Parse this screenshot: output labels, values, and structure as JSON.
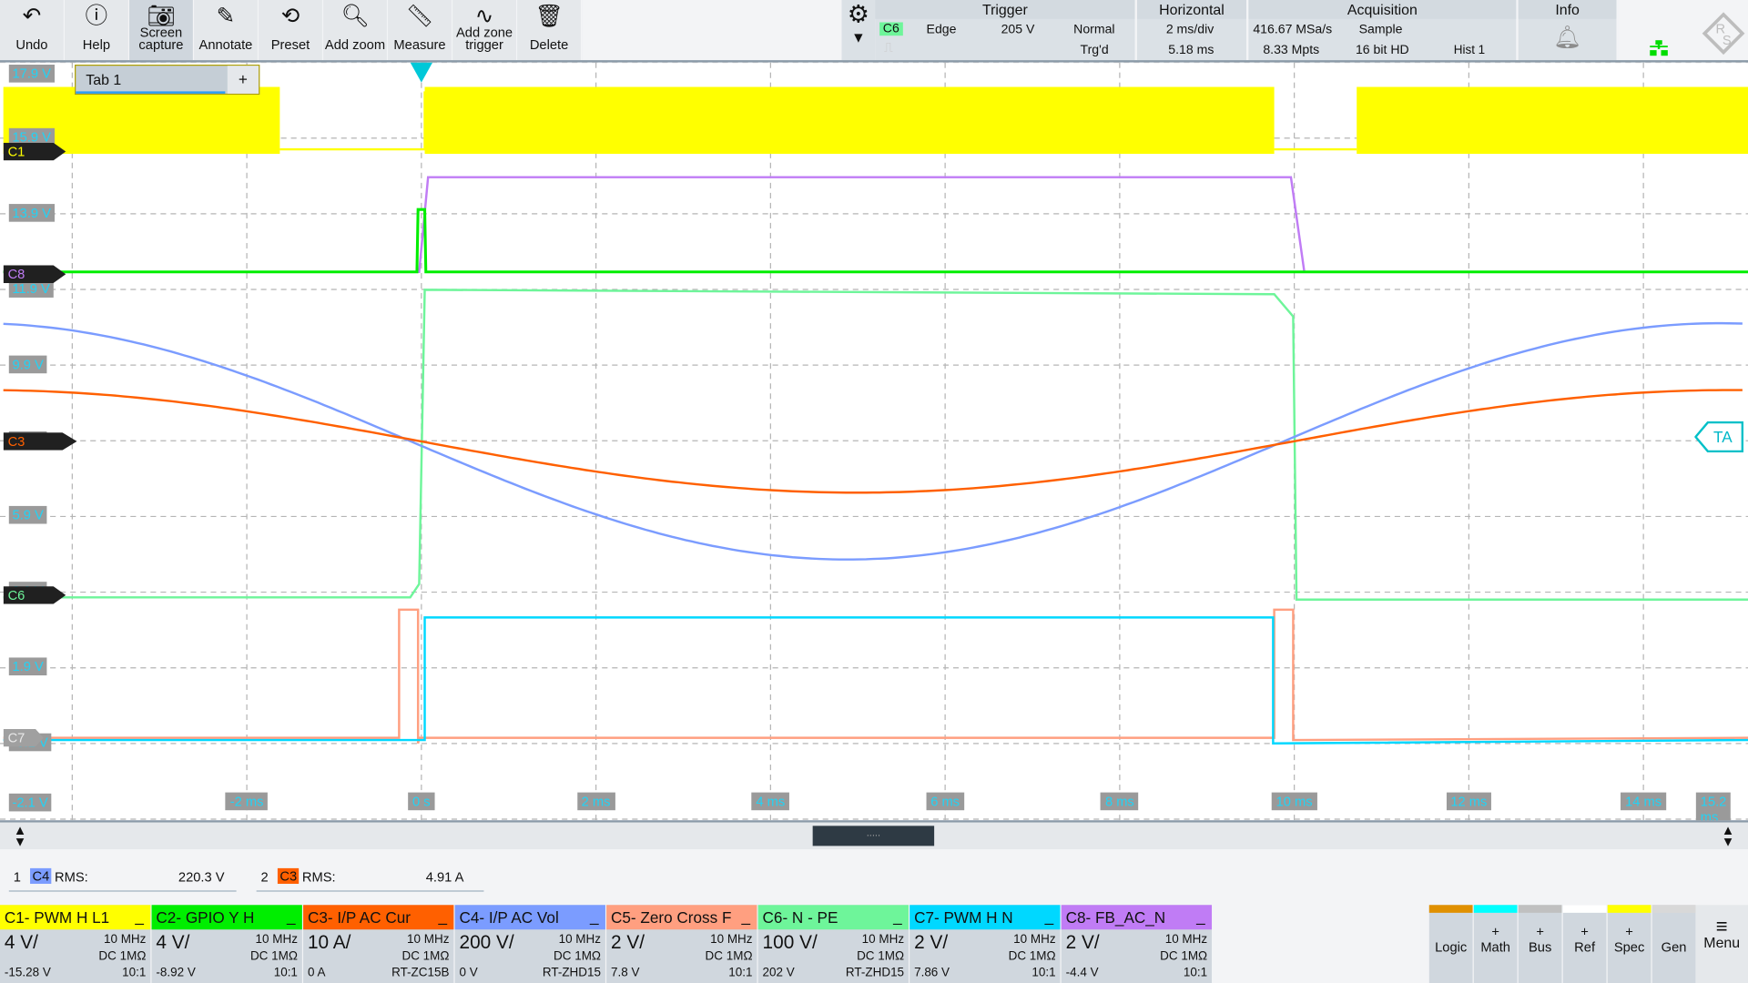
{
  "toolbar": {
    "buttons": [
      {
        "id": "undo",
        "label": "Undo",
        "icon": "undo-icon"
      },
      {
        "id": "help",
        "label": "Help",
        "icon": "help-icon"
      },
      {
        "id": "screen-capture",
        "label": "Screen capture",
        "icon": "camera-icon",
        "active": true
      },
      {
        "id": "annotate",
        "label": "Annotate",
        "icon": "pencil-icon"
      },
      {
        "id": "preset",
        "label": "Preset",
        "icon": "preset-icon"
      },
      {
        "id": "add-zoom",
        "label": "Add zoom",
        "icon": "zoom-plus-icon"
      },
      {
        "id": "measure",
        "label": "Measure",
        "icon": "ruler-icon"
      },
      {
        "id": "add-zone-trigger",
        "label": "Add zone trigger",
        "icon": "zone-trigger-icon"
      },
      {
        "id": "delete",
        "label": "Delete",
        "icon": "trash-icon"
      }
    ]
  },
  "trigger": {
    "title": "Trigger",
    "source": "C6",
    "source_color": "#6ef59a",
    "type": "Edge",
    "level": "205 V",
    "mode": "Normal",
    "state": "Trg'd"
  },
  "horizontal": {
    "title": "Horizontal",
    "scale": "2 ms/div",
    "position": "5.18 ms"
  },
  "acquisition": {
    "title": "Acquisition",
    "rate": "416.67 MSa/s",
    "points": "8.33 Mpts",
    "mode": "Sample",
    "resolution": "16 bit HD",
    "history": "Hist 1"
  },
  "info": {
    "title": "Info",
    "icon": "bell-icon"
  },
  "tabs": [
    {
      "label": "Tab 1"
    }
  ],
  "tab_add": "+",
  "y_labels": [
    "17.9 V",
    "15.9 V",
    "13.9 V",
    "11.9 V",
    "9.9 V",
    "7.9 V",
    "5.9 V",
    "3.9 V",
    "1.9 V",
    "-0.1 V",
    "-2.1 V"
  ],
  "x_labels": [
    "-2 ms",
    "0 s",
    "2 ms",
    "4 ms",
    "6 ms",
    "8 ms",
    "10 ms",
    "12 ms",
    "14 ms",
    "15.2 ms"
  ],
  "markers": [
    {
      "label": "C1",
      "color": "#ffff00"
    },
    {
      "label": "C8",
      "color": "#c07cf5"
    },
    {
      "label": "C3",
      "color": "#ff6000"
    },
    {
      "label": "C6",
      "color": "#6ef59a"
    },
    {
      "label": "C7",
      "color": "#00d8ff"
    }
  ],
  "ta_label": "TA",
  "measurements": [
    {
      "index": "1",
      "source": "C4",
      "source_color": "#7b9cff",
      "name": "RMS:",
      "value": "220.3 V"
    },
    {
      "index": "2",
      "source": "C3",
      "source_color": "#ff6000",
      "name": "RMS:",
      "value": "4.91 A"
    }
  ],
  "channels": [
    {
      "title": "C1- PWM H L1",
      "color": "#ffff00",
      "scale": "4 V/",
      "bw": "10 MHz",
      "coupling": "DC 1MΩ",
      "offset": "-15.28 V",
      "probe": "10:1"
    },
    {
      "title": "C2- GPIO Y H",
      "color": "#00ee00",
      "scale": "4 V/",
      "bw": "10 MHz",
      "coupling": "DC 1MΩ",
      "offset": "-8.92 V",
      "probe": "10:1"
    },
    {
      "title": "C3- I/P AC Cur",
      "color": "#ff6000",
      "scale": "10 A/",
      "bw": "10 MHz",
      "coupling": "DC 1MΩ",
      "offset": "0 A",
      "probe": "RT-ZC15B"
    },
    {
      "title": "C4- I/P AC Vol",
      "color": "#7b9cff",
      "scale": "200 V/",
      "bw": "10 MHz",
      "coupling": "DC 1MΩ",
      "offset": "0 V",
      "probe": "RT-ZHD15"
    },
    {
      "title": "C5- Zero Cross F",
      "color": "#ff9f80",
      "scale": "2 V/",
      "bw": "10 MHz",
      "coupling": "DC 1MΩ",
      "offset": "7.8 V",
      "probe": "10:1"
    },
    {
      "title": "C6- N - PE",
      "color": "#6ef59a",
      "scale": "100 V/",
      "bw": "10 MHz",
      "coupling": "DC 1MΩ",
      "offset": "202 V",
      "probe": "RT-ZHD15"
    },
    {
      "title": "C7- PWM H N",
      "color": "#00d8ff",
      "scale": "2 V/",
      "bw": "10 MHz",
      "coupling": "DC 1MΩ",
      "offset": "7.86 V",
      "probe": "10:1"
    },
    {
      "title": "C8- FB_AC_N",
      "color": "#c07cf5",
      "scale": "2 V/",
      "bw": "10 MHz",
      "coupling": "DC 1MΩ",
      "offset": "-4.4 V",
      "probe": "10:1"
    }
  ],
  "minimize": "_",
  "right_buttons": [
    {
      "label": "Logic",
      "plus": "",
      "color": "#e09000"
    },
    {
      "label": "Math",
      "plus": "+",
      "color": "#00ffff"
    },
    {
      "label": "Bus",
      "plus": "+",
      "color": "#c0c0c0"
    },
    {
      "label": "Ref",
      "plus": "+",
      "color": "#ffffff"
    },
    {
      "label": "Spec",
      "plus": "+",
      "color": "#ffff00"
    },
    {
      "label": "Gen",
      "plus": "",
      "color": "#d8d8d8"
    }
  ],
  "menu_label": "Menu",
  "scroll_handle": "....."
}
